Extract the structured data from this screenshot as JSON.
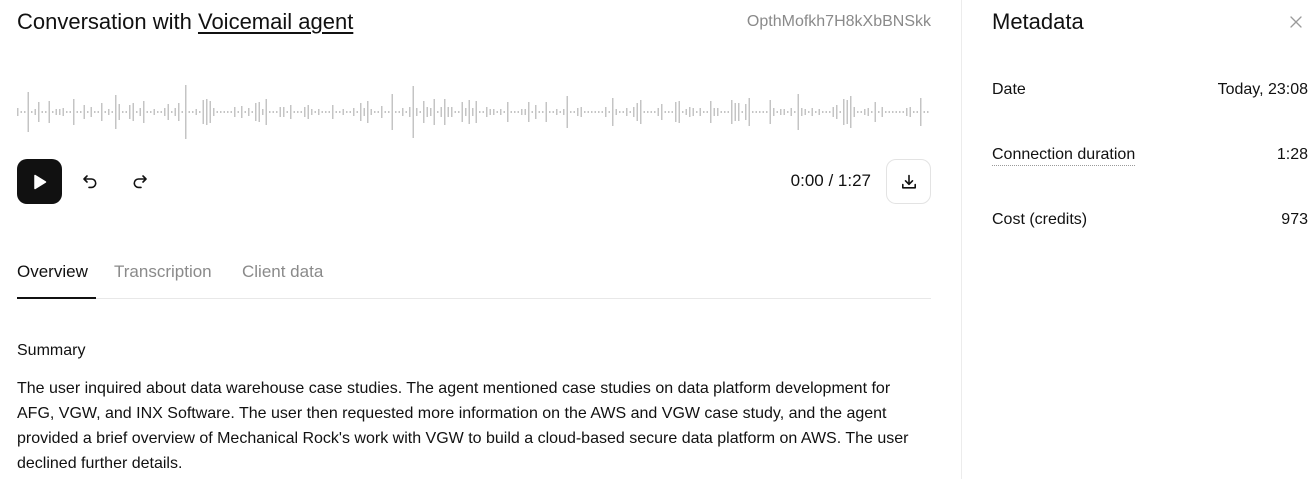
{
  "header": {
    "title_prefix": "Conversation with ",
    "agent_name": "Voicemail agent",
    "conversation_id": "OpthMofkh7H8kXbBNSkk"
  },
  "player": {
    "time_display": "0:00 / 1:27",
    "play_icon": "play-icon",
    "rewind_icon": "rewind-icon",
    "forward_icon": "forward-icon",
    "download_icon": "download-icon"
  },
  "tabs": [
    {
      "label": "Overview",
      "active": true
    },
    {
      "label": "Transcription",
      "active": false
    },
    {
      "label": "Client data",
      "active": false
    }
  ],
  "summary": {
    "heading": "Summary",
    "text": "The user inquired about data warehouse case studies. The agent mentioned case studies on data platform development for AFG, VGW, and INX Software. The user then requested more information on the AWS and VGW case study, and the agent provided a brief overview of Mechanical Rock's work with VGW to build a cloud-based secure data platform on AWS. The user declined further details."
  },
  "metadata": {
    "title": "Metadata",
    "close_icon": "close-icon",
    "rows": [
      {
        "label": "Date",
        "value": "Today, 23:08"
      },
      {
        "label": "Connection duration",
        "value": "1:28"
      },
      {
        "label": "Cost (credits)",
        "value": "973"
      }
    ]
  },
  "colors": {
    "waveform": "#c4c4c4",
    "play_button": "#111111",
    "muted_text": "#8a8a8a"
  }
}
